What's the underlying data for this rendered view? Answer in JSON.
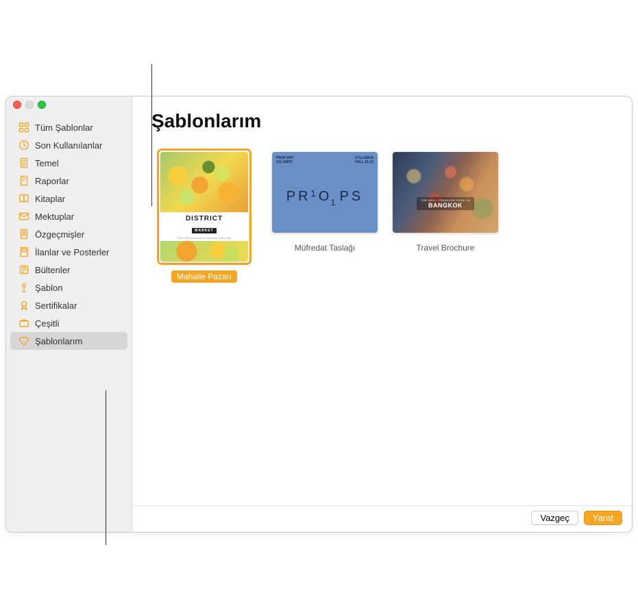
{
  "colors": {
    "accent": "#f5a623",
    "sidebar_bg": "#efefef"
  },
  "sidebar": {
    "items": [
      {
        "icon": "grid-icon",
        "label": "Tüm Şablonlar",
        "selected": false
      },
      {
        "icon": "clock-icon",
        "label": "Son Kullanılanlar",
        "selected": false
      },
      {
        "icon": "document-icon",
        "label": "Temel",
        "selected": false
      },
      {
        "icon": "report-icon",
        "label": "Raporlar",
        "selected": false
      },
      {
        "icon": "book-icon",
        "label": "Kitaplar",
        "selected": false
      },
      {
        "icon": "envelope-icon",
        "label": "Mektuplar",
        "selected": false
      },
      {
        "icon": "person-icon",
        "label": "Özgeçmişler",
        "selected": false
      },
      {
        "icon": "poster-icon",
        "label": "İlanlar ve Posterler",
        "selected": false
      },
      {
        "icon": "newsletter-icon",
        "label": "Bültenler",
        "selected": false
      },
      {
        "icon": "stationery-icon",
        "label": "Şablon",
        "selected": false
      },
      {
        "icon": "ribbon-icon",
        "label": "Sertifikalar",
        "selected": false
      },
      {
        "icon": "misc-icon",
        "label": "Çeşitli",
        "selected": false
      },
      {
        "icon": "heart-icon",
        "label": "Şablonlarım",
        "selected": true
      }
    ]
  },
  "main": {
    "title": "Şablonlarım",
    "templates": [
      {
        "label": "Mahalle Pazarı",
        "selected": true,
        "orientation": "portrait",
        "thumb": {
          "kind": "district",
          "line1": "DISTRICT",
          "line2": "MARKET",
          "line3": "Farm fresh products for the local community"
        }
      },
      {
        "label": "Müfredat Taslağı",
        "selected": false,
        "orientation": "landscape",
        "thumb": {
          "kind": "props",
          "top_left_1": "PROP ART",
          "top_left_2": "GO-10875",
          "top_right_1": "SYLLABUS",
          "top_right_2": "FALL 21-22",
          "center": "PROPS"
        }
      },
      {
        "label": "Travel Brochure",
        "selected": false,
        "orientation": "landscape",
        "thumb": {
          "kind": "bangkok",
          "small": "THE WELL-TRAVELED FORK IN",
          "big": "BANGKOK"
        }
      }
    ]
  },
  "footer": {
    "cancel": "Vazgeç",
    "create": "Yarat"
  }
}
